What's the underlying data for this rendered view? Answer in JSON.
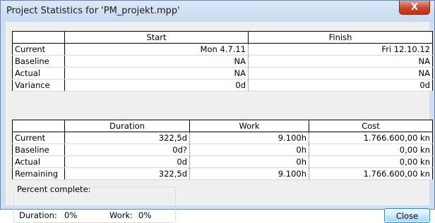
{
  "window": {
    "title": "Project Statistics for 'PM_projekt.mpp'",
    "close_glyph": "X"
  },
  "dates_table": {
    "headers": [
      "Start",
      "Finish"
    ],
    "rows": [
      {
        "label": "Current",
        "start": "Mon 4.7.11",
        "finish": "Fri 12.10.12"
      },
      {
        "label": "Baseline",
        "start": "NA",
        "finish": "NA"
      },
      {
        "label": "Actual",
        "start": "NA",
        "finish": "NA"
      },
      {
        "label": "Variance",
        "start": "0d",
        "finish": "0d"
      }
    ]
  },
  "stats_table": {
    "headers": [
      "Duration",
      "Work",
      "Cost"
    ],
    "rows": [
      {
        "label": "Current",
        "duration": "322,5d",
        "work": "9.100h",
        "cost": "1.766.600,00 kn"
      },
      {
        "label": "Baseline",
        "duration": "0d?",
        "work": "0h",
        "cost": "0,00 kn"
      },
      {
        "label": "Actual",
        "duration": "0d",
        "work": "0h",
        "cost": "0,00 kn"
      },
      {
        "label": "Remaining",
        "duration": "322,5d",
        "work": "9.100h",
        "cost": "1.766.600,00 kn"
      }
    ]
  },
  "percent_complete": {
    "group_label": "Percent complete:",
    "duration_label": "Duration:",
    "duration_value": "0%",
    "work_label": "Work:",
    "work_value": "0%"
  },
  "buttons": {
    "close_label": "Close"
  }
}
